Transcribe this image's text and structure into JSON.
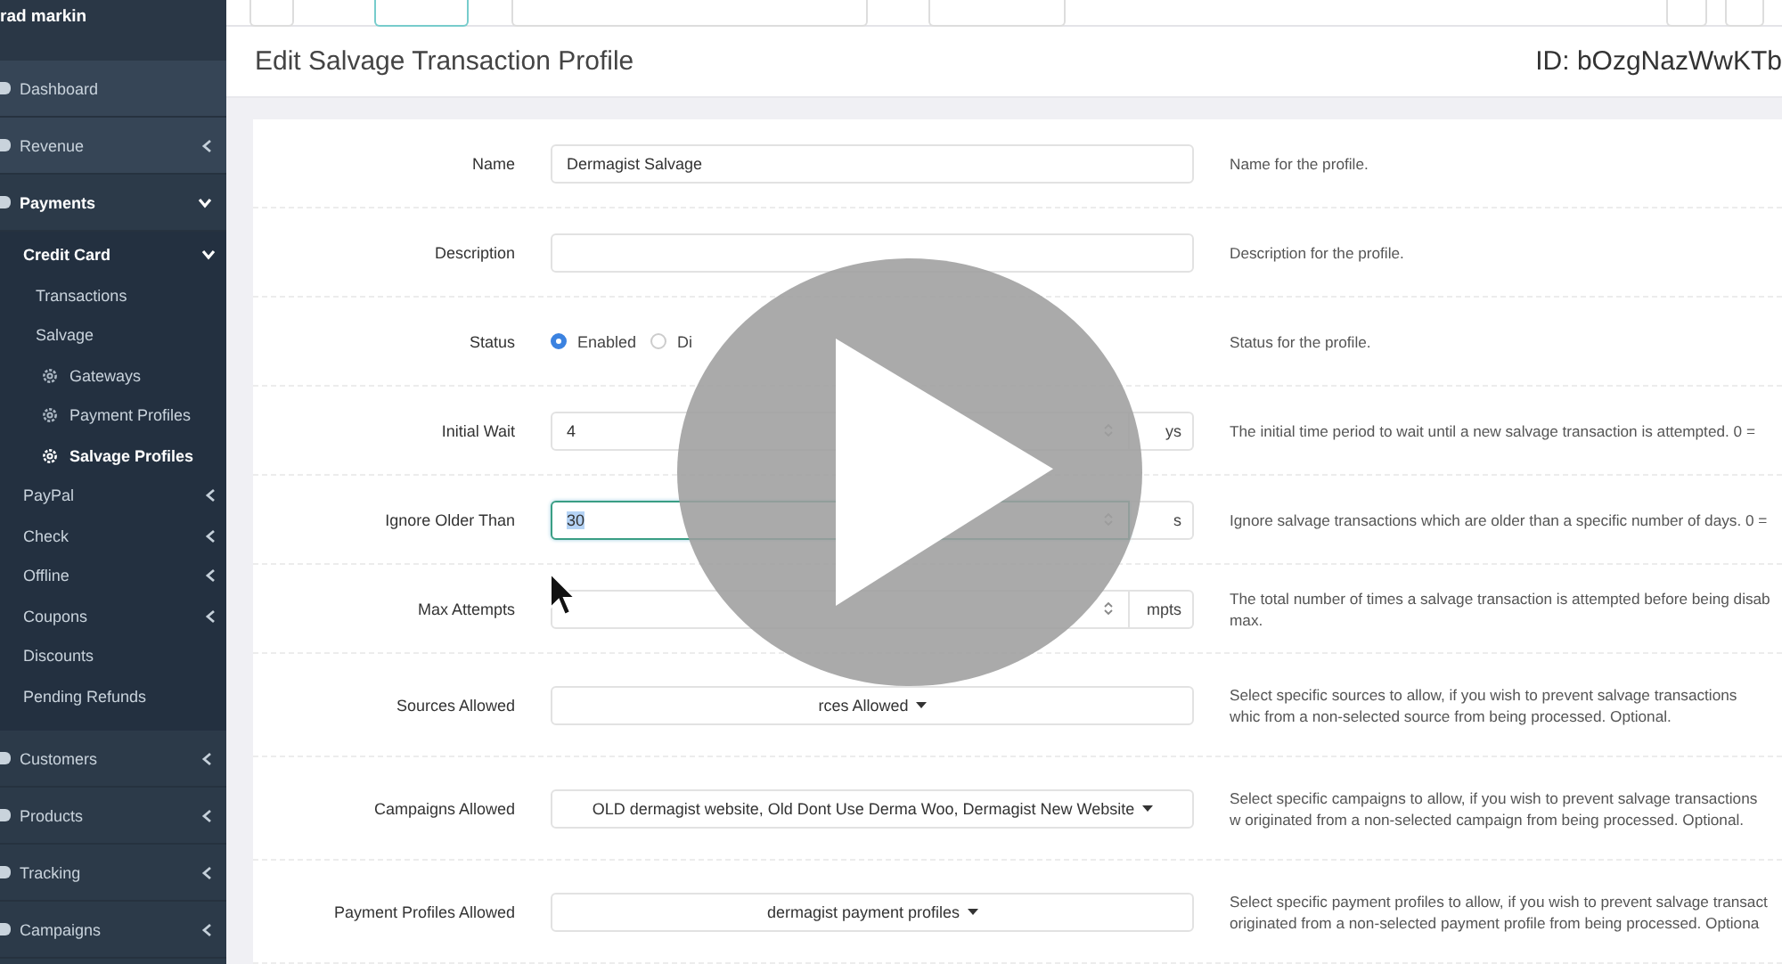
{
  "sidebar": {
    "user": "rad markin",
    "items": [
      {
        "label": "Dashboard",
        "kind": "link",
        "selected": false
      },
      {
        "label": "Revenue",
        "kind": "group",
        "expanded": false,
        "selected": false
      },
      {
        "label": "Payments",
        "kind": "group",
        "expanded": true,
        "selected": false,
        "children": [
          {
            "label": "Credit Card",
            "kind": "group",
            "expanded": true,
            "selected": false,
            "children": [
              {
                "label": "Transactions",
                "kind": "link",
                "selected": false
              },
              {
                "label": "Salvage",
                "kind": "link",
                "selected": false
              },
              {
                "label": "Gateways",
                "kind": "setting",
                "selected": false
              },
              {
                "label": "Payment Profiles",
                "kind": "setting",
                "selected": false
              },
              {
                "label": "Salvage Profiles",
                "kind": "setting",
                "selected": true
              }
            ]
          },
          {
            "label": "PayPal",
            "kind": "group",
            "expanded": false,
            "selected": false
          },
          {
            "label": "Check",
            "kind": "group",
            "expanded": false,
            "selected": false
          },
          {
            "label": "Offline",
            "kind": "group",
            "expanded": false,
            "selected": false
          },
          {
            "label": "Coupons",
            "kind": "group",
            "expanded": false,
            "selected": false
          },
          {
            "label": "Discounts",
            "kind": "link",
            "selected": false
          },
          {
            "label": "Pending Refunds",
            "kind": "link",
            "selected": false
          }
        ]
      },
      {
        "label": "Customers",
        "kind": "group",
        "expanded": false,
        "selected": false
      },
      {
        "label": "Products",
        "kind": "group",
        "expanded": false,
        "selected": false
      },
      {
        "label": "Tracking",
        "kind": "group",
        "expanded": false,
        "selected": false
      },
      {
        "label": "Campaigns",
        "kind": "group",
        "expanded": false,
        "selected": false
      }
    ]
  },
  "header": {
    "title": "Edit Salvage Transaction Profile",
    "id": "ID: bOzgNazWwKTb"
  },
  "form": {
    "rows": [
      {
        "kind": "text",
        "label": "Name",
        "value": "Dermagist Salvage",
        "help": "Name for the profile."
      },
      {
        "kind": "text",
        "label": "Description",
        "value": "",
        "help": "Description for the profile."
      },
      {
        "kind": "radio",
        "label": "Status",
        "options": [
          {
            "label": "Enabled",
            "selected": true
          },
          {
            "label": "Di",
            "selected": false
          }
        ],
        "help": "Status for the profile."
      },
      {
        "kind": "number",
        "label": "Initial Wait",
        "value": "4",
        "unit": "ys",
        "focused": false,
        "help": "The initial time period to wait until a new salvage transaction is attempted. 0 ="
      },
      {
        "kind": "number",
        "label": "Ignore Older Than",
        "value": "30",
        "unit": "s",
        "focused": true,
        "help": "Ignore salvage transactions which are older than a specific number of days. 0 ="
      },
      {
        "kind": "number",
        "label": "Max Attempts",
        "value": "",
        "unit": "mpts",
        "focused": false,
        "help": "The total number of times a salvage transaction is attempted before being disab max."
      },
      {
        "kind": "select",
        "label": "Sources Allowed",
        "value": "rces Allowed",
        "help": "Select specific sources to allow, if you wish to prevent salvage transactions whic from a non-selected source from being processed. Optional."
      },
      {
        "kind": "select",
        "label": "Campaigns Allowed",
        "value": "OLD dermagist website, Old Dont Use Derma Woo, Dermagist New Website",
        "help": "Select specific campaigns to allow, if you wish to prevent salvage transactions w originated from a non-selected campaign from being processed. Optional."
      },
      {
        "kind": "select",
        "label": "Payment Profiles Allowed",
        "value": "dermagist payment profiles",
        "help": "Select specific payment profiles to allow, if you wish to prevent salvage transact originated from a non-selected payment profile from being processed. Optiona"
      }
    ]
  }
}
